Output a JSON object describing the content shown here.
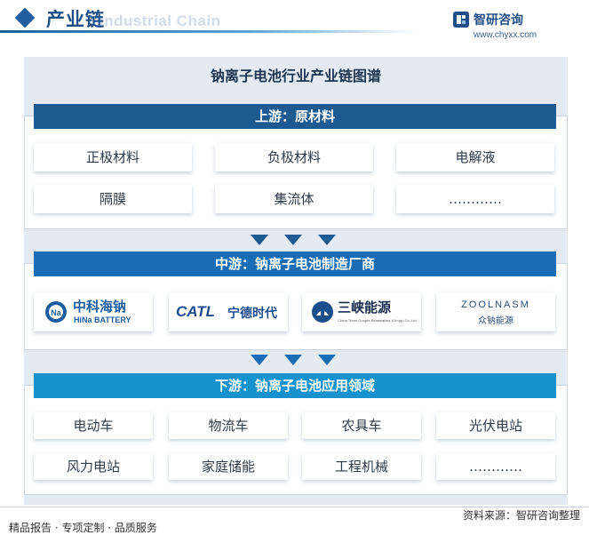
{
  "header": {
    "title": "产业链",
    "subtitle": "Industrial Chain"
  },
  "logo": {
    "name": "智研咨询",
    "url": "www.chyxx.com"
  },
  "diagram": {
    "title": "钠离子电池行业产业链图谱",
    "upstream": {
      "label": "上游：原材料",
      "items": [
        "正极材料",
        "负极材料",
        "电解液",
        "隔膜",
        "集流体",
        "…………"
      ]
    },
    "midstream": {
      "label": "中游：钠离子电池制造厂商",
      "companies": [
        {
          "name": "中科海钠",
          "sub": "HiNa BATTERY"
        },
        {
          "name": "CATL",
          "sub": "宁德时代"
        },
        {
          "name": "三峡能源",
          "sub": "China Three Gorges Renewables (Group) Co.,Ltd."
        },
        {
          "name": "ZOOLNASM",
          "sub": "众钠能源"
        }
      ]
    },
    "downstream": {
      "label": "下游：钠离子电池应用领域",
      "items": [
        "电动车",
        "物流车",
        "农具车",
        "光伏电站",
        "风力电站",
        "家庭储能",
        "工程机械",
        "…………"
      ]
    }
  },
  "footer": {
    "left": "精品报告 · 专项定制 · 品质服务",
    "right": "资料来源：智研咨询整理"
  },
  "colors": {
    "upstream_bar": "#1d5a91",
    "midstream_bar": "#1a6db4",
    "downstream_bar": "#1891cf",
    "panel_bg": "#e3eaf2"
  }
}
